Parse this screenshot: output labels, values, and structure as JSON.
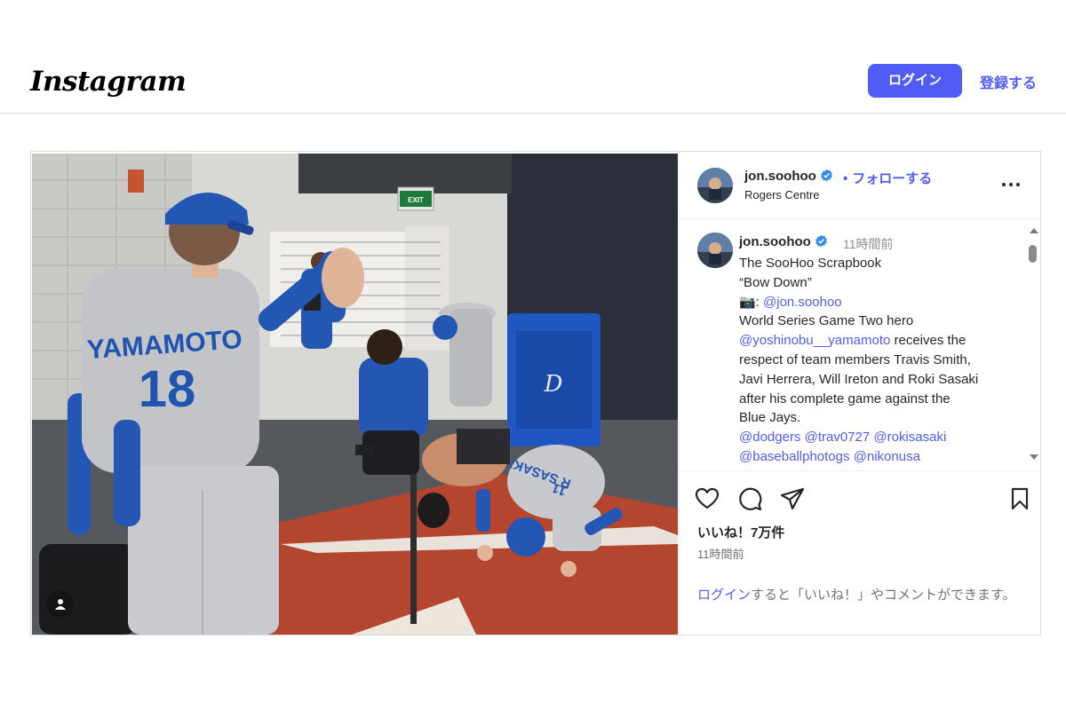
{
  "header": {
    "logo": "Instagram",
    "login_button": "ログイン",
    "signup_link": "登録する"
  },
  "post": {
    "username": "jon.soohoo",
    "follow": "フォローする",
    "follow_separator": "•",
    "location": "Rogers Centre",
    "caption": {
      "username": "jon.soohoo",
      "time": "11時間前",
      "lines": [
        [
          {
            "text": "The SooHoo Scrapbook"
          }
        ],
        [
          {
            "text": "“Bow Down”"
          }
        ],
        [
          {
            "text": "📷: "
          },
          {
            "text": "@jon.soohoo",
            "mention": true
          }
        ],
        [
          {
            "text": "World Series Game Two hero"
          }
        ],
        [
          {
            "text": "@yoshinobu__yamamoto",
            "mention": true
          },
          {
            "text": " receives the"
          }
        ],
        [
          {
            "text": "respect of team members Travis Smith,"
          }
        ],
        [
          {
            "text": "Javi Herrera, Will Ireton and Roki Sasaki"
          }
        ],
        [
          {
            "text": "after his complete game against the"
          }
        ],
        [
          {
            "text": "Blue Jays."
          }
        ],
        [
          {
            "text": "@dodgers",
            "mention": true
          },
          {
            "text": " "
          },
          {
            "text": "@trav0727",
            "mention": true
          },
          {
            "text": " "
          },
          {
            "text": "@rokisasaki",
            "mention": true
          }
        ],
        [
          {
            "text": "@baseballphotogs",
            "mention": true
          },
          {
            "text": " "
          },
          {
            "text": "@nikonusa",
            "mention": true
          }
        ]
      ]
    },
    "likes": "いいね！7万件",
    "timestamp": "11時間前",
    "login_prompt": {
      "link": "ログイン",
      "rest": "すると「いいね！」やコメントができます。"
    },
    "photo": {
      "jersey_name": "YAMAMOTO",
      "jersey_number": "18",
      "jersey_name_2": "R SASAKI",
      "jersey_number_2": "11",
      "exit_sign": "EXIT"
    }
  },
  "colors": {
    "accent": "#4f5cf5",
    "dodger_blue": "#2456b4",
    "dirt": "#b4452e",
    "border": "#dbdbdb"
  },
  "icons": [
    "heart-icon",
    "comment-icon",
    "share-icon",
    "bookmark-icon",
    "more-icon",
    "verified-icon",
    "user-tag-icon"
  ]
}
